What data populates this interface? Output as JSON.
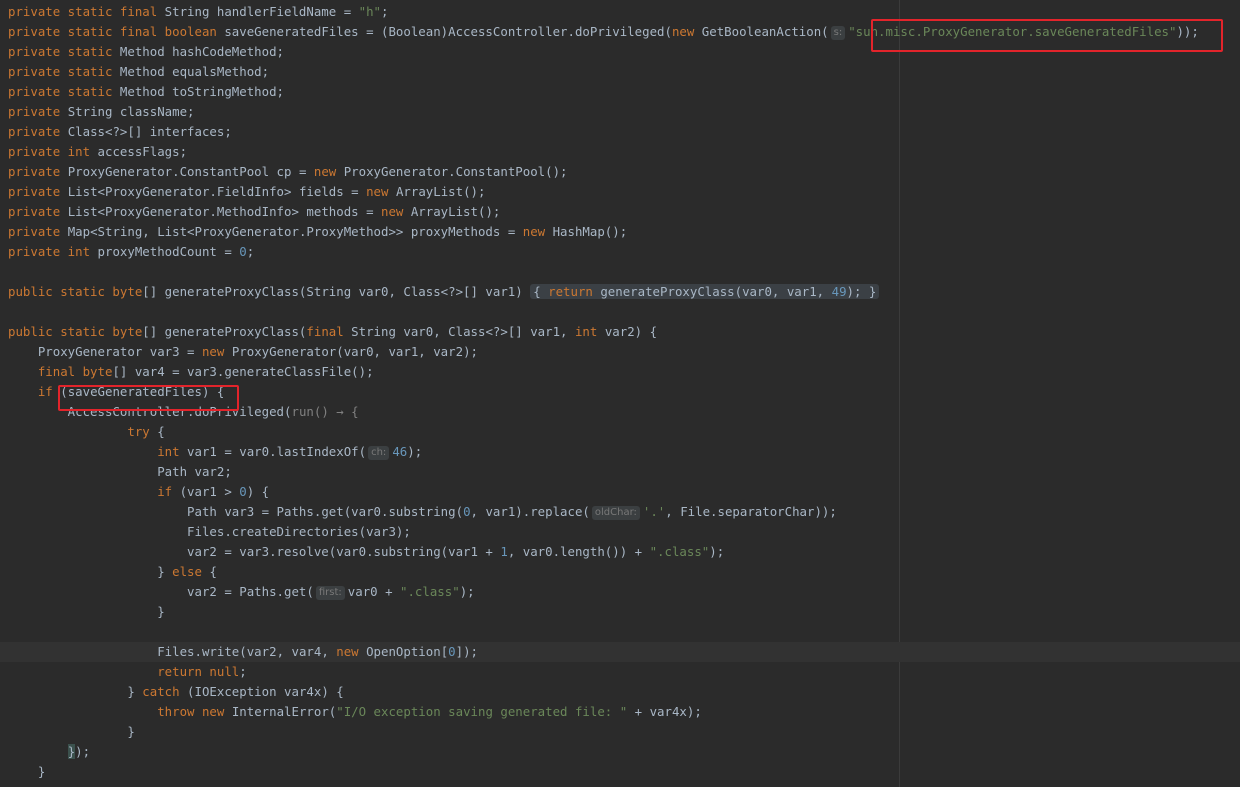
{
  "lines": [
    {
      "segs": [
        [
          "kw",
          "private static final "
        ],
        [
          "p",
          "String handlerFieldName = "
        ],
        [
          "str",
          "\"h\""
        ],
        [
          "p",
          ";"
        ]
      ]
    },
    {
      "segs": [
        [
          "kw",
          "private static final boolean "
        ],
        [
          "p",
          "saveGeneratedFiles = (Boolean)AccessController."
        ],
        [
          "p",
          "doPrivileged("
        ],
        [
          "kw",
          "new "
        ],
        [
          "p",
          "GetBooleanAction("
        ],
        [
          "hint",
          "s:"
        ],
        [
          "str",
          "\"sun.misc.ProxyGenerator.saveGeneratedFiles\""
        ],
        [
          "p",
          "));"
        ]
      ]
    },
    {
      "segs": [
        [
          "kw",
          "private static "
        ],
        [
          "p",
          "Method hashCodeMethod;"
        ]
      ]
    },
    {
      "segs": [
        [
          "kw",
          "private static "
        ],
        [
          "p",
          "Method equalsMethod;"
        ]
      ]
    },
    {
      "segs": [
        [
          "kw",
          "private static "
        ],
        [
          "p",
          "Method toStringMethod;"
        ]
      ]
    },
    {
      "segs": [
        [
          "kw",
          "private "
        ],
        [
          "p",
          "String className;"
        ]
      ]
    },
    {
      "segs": [
        [
          "kw",
          "private "
        ],
        [
          "p",
          "Class<?>[] interfaces;"
        ]
      ]
    },
    {
      "segs": [
        [
          "kw",
          "private int "
        ],
        [
          "p",
          "accessFlags;"
        ]
      ]
    },
    {
      "segs": [
        [
          "kw",
          "private "
        ],
        [
          "p",
          "ProxyGenerator.ConstantPool cp = "
        ],
        [
          "kw",
          "new "
        ],
        [
          "p",
          "ProxyGenerator.ConstantPool();"
        ]
      ]
    },
    {
      "segs": [
        [
          "kw",
          "private "
        ],
        [
          "p",
          "List<ProxyGenerator.FieldInfo> fields = "
        ],
        [
          "kw",
          "new "
        ],
        [
          "p",
          "ArrayList();"
        ]
      ]
    },
    {
      "segs": [
        [
          "kw",
          "private "
        ],
        [
          "p",
          "List<ProxyGenerator.MethodInfo> methods = "
        ],
        [
          "kw",
          "new "
        ],
        [
          "p",
          "ArrayList();"
        ]
      ]
    },
    {
      "segs": [
        [
          "kw",
          "private "
        ],
        [
          "p",
          "Map<String, List<ProxyGenerator.ProxyMethod>> proxyMethods = "
        ],
        [
          "kw",
          "new "
        ],
        [
          "p",
          "HashMap();"
        ]
      ]
    },
    {
      "segs": [
        [
          "kw",
          "private int "
        ],
        [
          "p",
          "proxyMethodCount = "
        ],
        [
          "num",
          "0"
        ],
        [
          "p",
          ";"
        ]
      ]
    },
    {
      "segs": []
    },
    {
      "segs": [
        [
          "kw",
          "public static byte"
        ],
        [
          "p",
          "[] generateProxyClass(String var0, Class<?>[] var1) "
        ],
        [
          "fold-open",
          "{ "
        ],
        [
          "fold-kw",
          "return "
        ],
        [
          "fold",
          "generateProxyClass(var0, var1, "
        ],
        [
          "fold-num",
          "49"
        ],
        [
          "fold",
          "); "
        ],
        [
          "fold-close",
          "}"
        ]
      ]
    },
    {
      "segs": []
    },
    {
      "segs": [
        [
          "kw",
          "public static byte"
        ],
        [
          "p",
          "[] generateProxyClass("
        ],
        [
          "kw",
          "final "
        ],
        [
          "p",
          "String var0, Class<?>[] var1, "
        ],
        [
          "kw",
          "int "
        ],
        [
          "p",
          "var2) {"
        ]
      ]
    },
    {
      "segs": [
        [
          "p",
          "    ProxyGenerator var3 = "
        ],
        [
          "kw",
          "new "
        ],
        [
          "p",
          "ProxyGenerator(var0, var1, var2);"
        ]
      ]
    },
    {
      "segs": [
        [
          "p",
          "    "
        ],
        [
          "kw",
          "final byte"
        ],
        [
          "p",
          "[] var4 = var3.generateClassFile();"
        ]
      ]
    },
    {
      "segs": [
        [
          "p",
          "    "
        ],
        [
          "kw",
          "if "
        ],
        [
          "p",
          "(saveGeneratedFiles) {"
        ]
      ]
    },
    {
      "segs": [
        [
          "p",
          "        AccessController."
        ],
        [
          "p",
          "doPrivileged("
        ],
        [
          "lambda",
          "run() → {"
        ]
      ]
    },
    {
      "segs": [
        [
          "p",
          "                "
        ],
        [
          "kw",
          "try "
        ],
        [
          "p",
          "{"
        ]
      ]
    },
    {
      "segs": [
        [
          "p",
          "                    "
        ],
        [
          "kw",
          "int "
        ],
        [
          "p",
          "var1 = var0.lastIndexOf("
        ],
        [
          "hint",
          "ch:"
        ],
        [
          "num",
          "46"
        ],
        [
          "p",
          ");"
        ]
      ]
    },
    {
      "segs": [
        [
          "p",
          "                    Path var2;"
        ]
      ]
    },
    {
      "segs": [
        [
          "p",
          "                    "
        ],
        [
          "kw",
          "if "
        ],
        [
          "p",
          "(var1 > "
        ],
        [
          "num",
          "0"
        ],
        [
          "p",
          ") {"
        ]
      ]
    },
    {
      "segs": [
        [
          "p",
          "                        Path var3 = Paths."
        ],
        [
          "p",
          "get(var0.substring("
        ],
        [
          "num",
          "0"
        ],
        [
          "p",
          ", var1).replace("
        ],
        [
          "hint",
          "oldChar:"
        ],
        [
          "str",
          "'.'"
        ],
        [
          "p",
          ", File."
        ],
        [
          "p",
          "separatorChar));"
        ]
      ]
    },
    {
      "segs": [
        [
          "p",
          "                        Files."
        ],
        [
          "p",
          "createDirectories(var3);"
        ]
      ]
    },
    {
      "segs": [
        [
          "p",
          "                        var2 = var3.resolve(var0.substring(var1 + "
        ],
        [
          "num",
          "1"
        ],
        [
          "p",
          ", var0.length()) + "
        ],
        [
          "str",
          "\".class\""
        ],
        [
          "p",
          ");"
        ]
      ]
    },
    {
      "segs": [
        [
          "p",
          "                    } "
        ],
        [
          "kw",
          "else "
        ],
        [
          "p",
          "{"
        ]
      ]
    },
    {
      "segs": [
        [
          "p",
          "                        var2 = Paths."
        ],
        [
          "p",
          "get("
        ],
        [
          "hint",
          "first:"
        ],
        [
          "p",
          "var0 + "
        ],
        [
          "str",
          "\".class\""
        ],
        [
          "p",
          ");"
        ]
      ]
    },
    {
      "segs": [
        [
          "p",
          "                    }"
        ]
      ]
    },
    {
      "segs": []
    },
    {
      "segs": [
        [
          "p",
          "                    Files."
        ],
        [
          "p",
          "write(var2, var4, "
        ],
        [
          "kw",
          "new "
        ],
        [
          "p",
          "OpenOption["
        ],
        [
          "num",
          "0"
        ],
        [
          "p",
          "]);"
        ]
      ],
      "current": true
    },
    {
      "segs": [
        [
          "p",
          "                    "
        ],
        [
          "kw",
          "return null"
        ],
        [
          "p",
          ";"
        ]
      ]
    },
    {
      "segs": [
        [
          "p",
          "                } "
        ],
        [
          "kw",
          "catch "
        ],
        [
          "p",
          "(IOException var4x) {"
        ]
      ]
    },
    {
      "segs": [
        [
          "p",
          "                    "
        ],
        [
          "kw",
          "throw new "
        ],
        [
          "p",
          "InternalError("
        ],
        [
          "str",
          "\"I/O exception saving generated file: \""
        ],
        [
          "p",
          " + var4x);"
        ]
      ]
    },
    {
      "segs": [
        [
          "p",
          "                }"
        ]
      ]
    },
    {
      "segs": [
        [
          "p",
          "        "
        ],
        [
          "brace",
          "}"
        ],
        [
          "p",
          ");"
        ]
      ]
    },
    {
      "segs": [
        [
          "p",
          "    }"
        ]
      ]
    }
  ],
  "highlights": [
    {
      "label": "save-generated-files-property-box"
    },
    {
      "label": "if-save-generated-files-box"
    }
  ]
}
